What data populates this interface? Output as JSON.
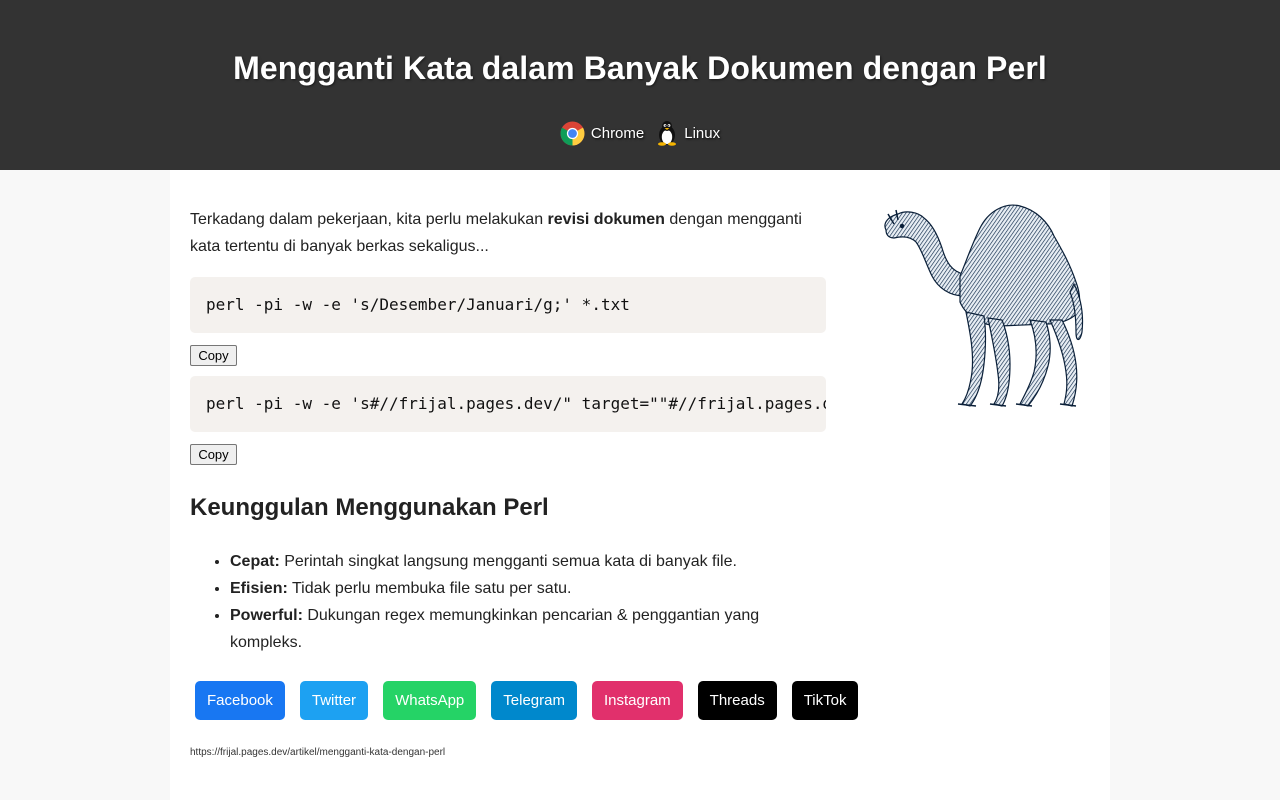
{
  "header": {
    "title": "Mengganti Kata dalam Banyak Dokumen dengan Perl",
    "tags": [
      {
        "label": "Chrome",
        "icon": "chrome-icon"
      },
      {
        "label": "Linux",
        "icon": "linux-tux-icon"
      }
    ]
  },
  "article": {
    "intro_before": "Terkadang dalam pekerjaan, kita perlu melakukan ",
    "intro_bold": "revisi dokumen",
    "intro_after": " dengan mengganti kata tertentu di banyak berkas sekaligus...",
    "code_blocks": [
      "perl -pi -w -e 's/Desember/Januari/g;' *.txt",
      "perl -pi -w -e 's#//frijal.pages.dev/\" target=\"\"#//frijal.pages.dev/\" target=\"_blank\"#g;' *.html"
    ],
    "copy_label": "Copy",
    "heading": "Keunggulan Menggunakan Perl",
    "advantages": [
      {
        "term": "Cepat:",
        "desc": " Perintah singkat langsung mengganti semua kata di banyak file."
      },
      {
        "term": "Efisien:",
        "desc": " Tidak perlu membuka file satu per satu."
      },
      {
        "term": "Powerful:",
        "desc": " Dukungan regex memungkinkan pencarian & penggantian yang kompleks."
      }
    ],
    "share_buttons": [
      {
        "label": "Facebook",
        "color": "#1877f2"
      },
      {
        "label": "Twitter",
        "color": "#1da1f2"
      },
      {
        "label": "WhatsApp",
        "color": "#25d366"
      },
      {
        "label": "Telegram",
        "color": "#0088cc"
      },
      {
        "label": "Instagram",
        "color": "#e1306c"
      },
      {
        "label": "Threads",
        "color": "#000000"
      },
      {
        "label": "TikTok",
        "color": "#000000"
      }
    ],
    "url": "https://frijal.pages.dev/artikel/mengganti-kata-dengan-perl"
  },
  "sidebar": {
    "image": "perl-camel-illustration"
  }
}
